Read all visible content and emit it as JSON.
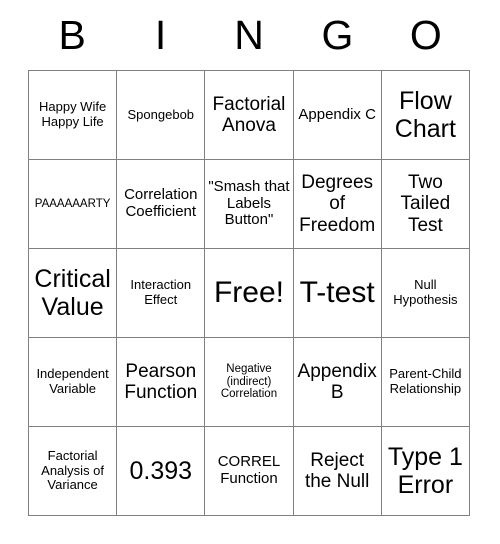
{
  "header": {
    "letters": [
      "B",
      "I",
      "N",
      "G",
      "O"
    ]
  },
  "grid": {
    "columns": 5,
    "rows": 5,
    "border_color": "#808080",
    "background_color": "#ffffff",
    "text_color": "#000000",
    "cells": [
      {
        "text": "Happy Wife Happy Life",
        "size": "s"
      },
      {
        "text": "Spongebob",
        "size": "s"
      },
      {
        "text": "Factorial Anova",
        "size": "l"
      },
      {
        "text": "Appendix C",
        "size": "m"
      },
      {
        "text": "Flow Chart",
        "size": "xl"
      },
      {
        "text": "PAAAAAARTY",
        "size": "xs"
      },
      {
        "text": "Correlation Coefficient",
        "size": "m"
      },
      {
        "text": "\"Smash that Labels Button\"",
        "size": "m"
      },
      {
        "text": "Degrees of Freedom",
        "size": "l"
      },
      {
        "text": "Two Tailed Test",
        "size": "l"
      },
      {
        "text": "Critical Value",
        "size": "xl"
      },
      {
        "text": "Interaction Effect",
        "size": "s"
      },
      {
        "text": "Free!",
        "size": "xxl"
      },
      {
        "text": "T-test",
        "size": "xxl"
      },
      {
        "text": "Null Hypothesis",
        "size": "s"
      },
      {
        "text": "Independent Variable",
        "size": "s"
      },
      {
        "text": "Pearson Function",
        "size": "l"
      },
      {
        "text": "Negative (indirect) Correlation",
        "size": "xs"
      },
      {
        "text": "Appendix B",
        "size": "l"
      },
      {
        "text": "Parent-Child Relationship",
        "size": "s"
      },
      {
        "text": "Factorial Analysis of Variance",
        "size": "s"
      },
      {
        "text": "0.393",
        "size": "xl"
      },
      {
        "text": "CORREL Function",
        "size": "m"
      },
      {
        "text": "Reject the Null",
        "size": "l"
      },
      {
        "text": "Type 1 Error",
        "size": "xl"
      }
    ]
  }
}
